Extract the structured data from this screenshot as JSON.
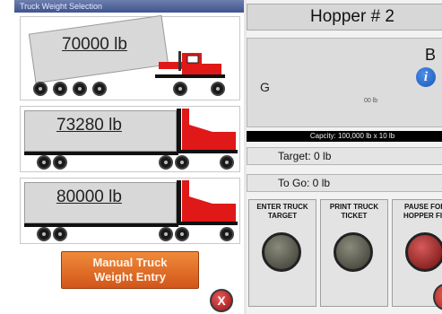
{
  "left_panel": {
    "title": "Truck Weight Selection",
    "trucks": [
      {
        "weight": "70000 lb"
      },
      {
        "weight": "73280 lb"
      },
      {
        "weight": "80000 lb"
      }
    ],
    "manual_button_line1": "Manual Truck",
    "manual_button_line2": "Weight Entry",
    "close_label": "X"
  },
  "right_panel": {
    "hopper_title": "Hopper # 2",
    "display": {
      "left_indicator": "G",
      "right_indicator": "B",
      "units_label": "00 lb",
      "capacity": "Capcity: 100,000 lb x 10 lb"
    },
    "target": "Target: 0 lb",
    "to_go": "To Go: 0 lb",
    "controls": [
      {
        "line1": "ENTER TRUCK",
        "line2": "TARGET"
      },
      {
        "line1": "PRINT TRUCK",
        "line2": "TICKET"
      },
      {
        "line1": "PAUSE FOR",
        "line2": "HOPPER FIL"
      }
    ]
  },
  "colors": {
    "cab_red": "#e01818",
    "manual_orange": "#e06b25",
    "capacity_bar": "#000000",
    "info_blue": "#1e6ad0"
  }
}
